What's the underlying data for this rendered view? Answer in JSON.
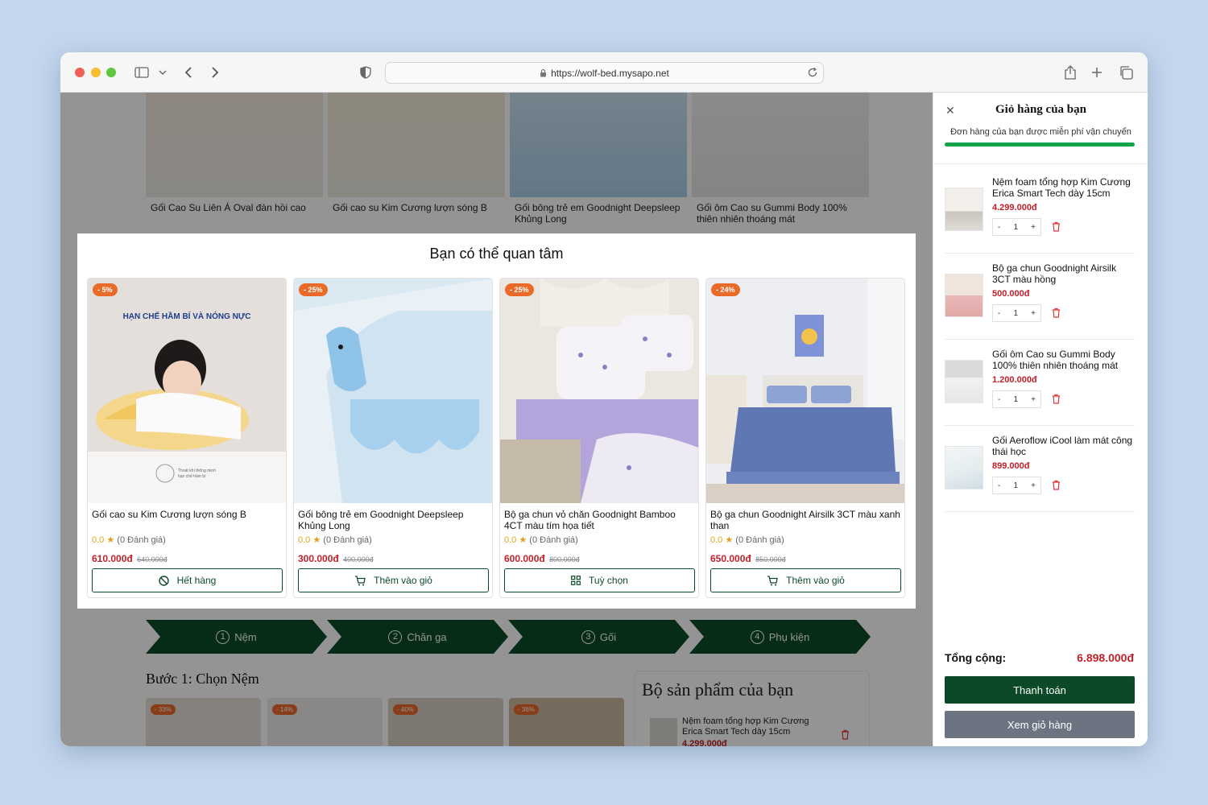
{
  "browser": {
    "url": "https://wolf-bed.mysapo.net"
  },
  "background_page": {
    "top_products": [
      {
        "name": "Gối Cao Su Liên Á Oval đàn hồi cao"
      },
      {
        "name": "Gối cao su Kim Cương lượn sóng B"
      },
      {
        "name": "Gối bông trẻ em Goodnight Deepsleep Khủng Long"
      },
      {
        "name": "Gối ôm Cao su Gummi Body 100% thiên nhiên thoáng mát"
      }
    ],
    "steps": [
      {
        "num": "1",
        "label": "Nệm"
      },
      {
        "num": "2",
        "label": "Chăn ga"
      },
      {
        "num": "3",
        "label": "Gối"
      },
      {
        "num": "4",
        "label": "Phụ kiện"
      }
    ],
    "step1_title": "Bước 1: Chọn Nệm",
    "bottom_badges": [
      "- 33%",
      "- 14%",
      "- 40%",
      "- 36%"
    ],
    "bundle": {
      "title": "Bộ sản phẩm của bạn",
      "item_name": "Nệm foam tổng hợp Kim Cương Erica Smart Tech dày 15cm",
      "item_price": "4.299.000đ"
    }
  },
  "modal": {
    "title": "Bạn có thể quan tâm",
    "products": [
      {
        "badge": "- 5%",
        "image_text": "HẠN CHẾ HẦM BÍ VÀ NÓNG NỰC",
        "name": "Gối cao su Kim Cương lượn sóng B",
        "rating": "0.0",
        "reviews": "(0 Đánh giá)",
        "price": "610.000đ",
        "old_price": "640.000đ",
        "button": "Hết hàng",
        "button_icon": "ban-icon"
      },
      {
        "badge": "- 25%",
        "name": "Gối bông trẻ em Goodnight Deepsleep Khủng Long",
        "rating": "0.0",
        "reviews": "(0 Đánh giá)",
        "price": "300.000đ",
        "old_price": "400.000đ",
        "button": "Thêm vào giỏ",
        "button_icon": "cart-icon"
      },
      {
        "badge": "- 25%",
        "name": "Bộ ga chun vỏ chăn Goodnight Bamboo 4CT màu tím họa tiết",
        "rating": "0.0",
        "reviews": "(0 Đánh giá)",
        "price": "600.000đ",
        "old_price": "800.000đ",
        "button": "Tuỳ chọn",
        "button_icon": "grid-icon"
      },
      {
        "badge": "- 24%",
        "name": "Bộ ga chun Goodnight Airsilk 3CT màu xanh than",
        "rating": "0.0",
        "reviews": "(0 Đánh giá)",
        "price": "650.000đ",
        "old_price": "850.000đ",
        "button": "Thêm vào giỏ",
        "button_icon": "cart-icon"
      }
    ]
  },
  "cart": {
    "title": "Giỏ hàng của bạn",
    "shipping_message": "Đơn hàng của bạn được miễn phí vận chuyển",
    "shipping_progress": 1.0,
    "items": [
      {
        "name": "Nệm foam tổng hợp Kim Cương Erica Smart Tech dày 15cm",
        "price": "4.299.000đ",
        "qty": "1"
      },
      {
        "name": "Bộ ga chun Goodnight Airsilk 3CT màu hồng",
        "price": "500.000đ",
        "qty": "1"
      },
      {
        "name": "Gối ôm Cao su Gummi Body 100% thiên nhiên thoáng mát",
        "price": "1.200.000đ",
        "qty": "1"
      },
      {
        "name": "Gối Aeroflow iCool làm mát công thái học",
        "price": "899.000đ",
        "qty": "1"
      }
    ],
    "total_label": "Tổng cộng:",
    "total_value": "6.898.000đ",
    "checkout_label": "Thanh toán",
    "view_cart_label": "Xem giỏ hàng"
  },
  "colors": {
    "brand_green": "#0c4a27",
    "price_red": "#c0202a",
    "badge_orange": "#ea6a2a",
    "progress_green": "#12a34a"
  }
}
